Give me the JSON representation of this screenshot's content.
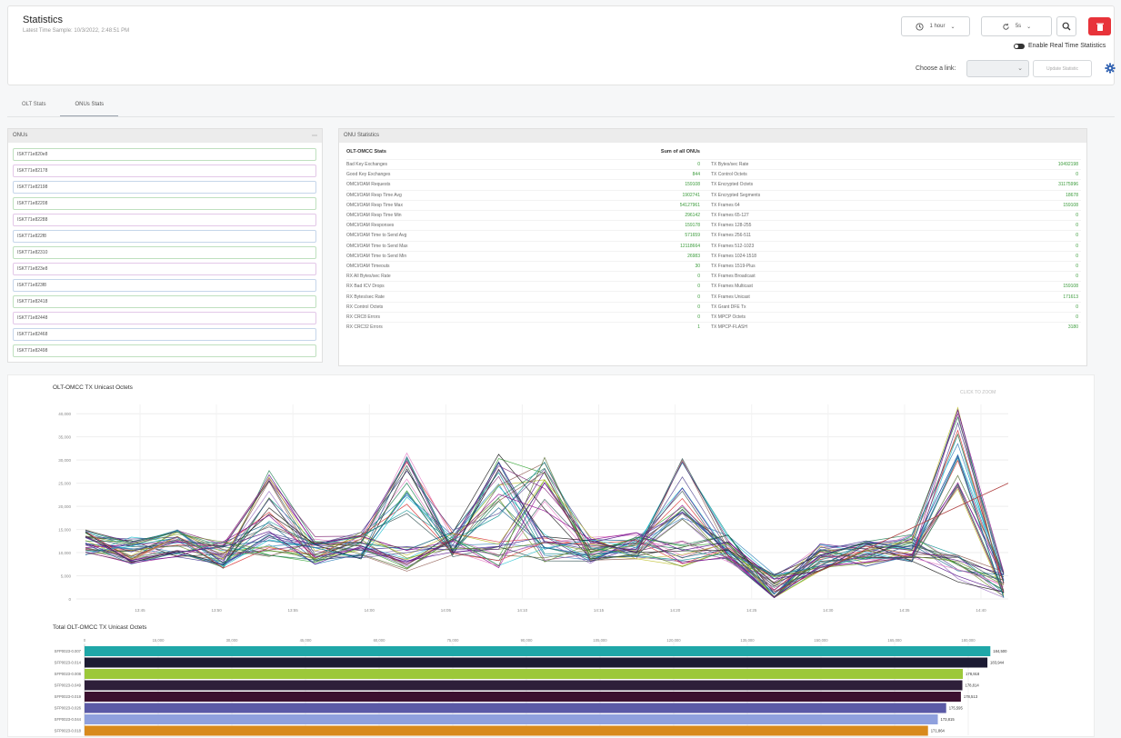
{
  "header": {
    "title": "Statistics",
    "subtitle": "Latest Time Sample: 10/3/2022, 2:48:51 PM",
    "time_range": "1 hour",
    "interval": "5s",
    "toggle_label": "Enable Real Time Statistics",
    "choose_link_label": "Choose a link:",
    "update_button": "Update Statistic"
  },
  "tabs": [
    "OLT Stats",
    "ONUs Stats"
  ],
  "left_panel": {
    "title": "ONUs",
    "items": [
      "ISKT71e820e8",
      "ISKT71e82178",
      "ISKT71e82198",
      "ISKT71e82208",
      "ISKT71e82288",
      "ISKT71e822f8",
      "ISKT71e82310",
      "ISKT71e823e8",
      "ISKT71e823f8",
      "ISKT71e82418",
      "ISKT71e82448",
      "ISKT71e82468",
      "ISKT71e82498"
    ]
  },
  "right_panel": {
    "title": "ONU Statistics",
    "col1_header": "OLT-OMCC Stats",
    "col2_header": "Sum of all ONUs",
    "rows": [
      {
        "name": "Bad Key Exchanges",
        "value": "0",
        "name2": "TX Bytes/sec Rate",
        "value2": "10492198"
      },
      {
        "name": "Good Key Exchanges",
        "value": "844",
        "name2": "TX Control Octets",
        "value2": "0"
      },
      {
        "name": "OMCI/OAM Requests",
        "value": "159108",
        "name2": "TX Encrypted Octets",
        "value2": "31175996"
      },
      {
        "name": "OMCI/OAM Resp Time Avg",
        "value": "1902741",
        "name2": "TX Encrypted Segments",
        "value2": "18678"
      },
      {
        "name": "OMCI/OAM Resp Time Max",
        "value": "54127961",
        "name2": "TX Frames 64",
        "value2": "159108"
      },
      {
        "name": "OMCI/OAM Resp Time Min",
        "value": "296142",
        "name2": "TX Frames 65-127",
        "value2": "0"
      },
      {
        "name": "OMCI/OAM Responses",
        "value": "159178",
        "name2": "TX Frames 128-255",
        "value2": "0"
      },
      {
        "name": "OMCI/OAM Time to Send Avg",
        "value": "571659",
        "name2": "TX Frames 256-511",
        "value2": "0"
      },
      {
        "name": "OMCI/OAM Time to Send Max",
        "value": "12118664",
        "name2": "TX Frames 512-1023",
        "value2": "0"
      },
      {
        "name": "OMCI/OAM Time to Send Min",
        "value": "26983",
        "name2": "TX Frames 1024-1518",
        "value2": "0"
      },
      {
        "name": "OMCI/OAM Timeouts",
        "value": "30",
        "name2": "TX Frames 1519-Plus",
        "value2": "0"
      },
      {
        "name": "RX All Bytes/sec Rate",
        "value": "0",
        "name2": "TX Frames Broadcast",
        "value2": "0"
      },
      {
        "name": "RX Bad ICV Drops",
        "value": "0",
        "name2": "TX Frames Multicast",
        "value2": "159108"
      },
      {
        "name": "RX Bytes/sec Rate",
        "value": "0",
        "name2": "TX Frames Unicast",
        "value2": "171613"
      },
      {
        "name": "RX Control Octets",
        "value": "0",
        "name2": "TX Grant DFE Tx",
        "value2": "0"
      },
      {
        "name": "RX CRC8 Errors",
        "value": "0",
        "name2": "TX MPCP Octets",
        "value2": "0"
      },
      {
        "name": "RX CRC32 Errors",
        "value": "1",
        "name2": "TX MPCP-FLASH",
        "value2": "3180"
      }
    ]
  },
  "line_chart_title": "OLT-OMCC TX Unicast Octets",
  "reset_zoom": "CLICK TO ZOOM",
  "bar_chart_title": "Total OLT-OMCC TX Unicast Octets",
  "colors": {
    "accent_red": "#e8333a",
    "value_green": "#3a9a3a"
  },
  "icons": {
    "clock": "clock-icon",
    "refresh": "refresh-icon",
    "zoom": "zoom-icon",
    "delete": "trash-icon",
    "settings": "gear-icon"
  },
  "chart_data": [
    {
      "type": "line",
      "title": "OLT-OMCC TX Unicast Octets",
      "y_ticks": [
        "40,000",
        "35,000",
        "30,000",
        "25,000",
        "20,000",
        "15,000",
        "10,000",
        "5,000",
        "0"
      ],
      "x_ticks": [
        "13:45",
        "13:50",
        "13:55",
        "14:00",
        "14:05",
        "14:10",
        "14:15",
        "14:20",
        "14:25",
        "14:30",
        "14:35",
        "14:40"
      ],
      "ylim": [
        0,
        42000
      ],
      "series_count": 40,
      "profile": [
        12000,
        10500,
        12000,
        9500,
        12000,
        10500,
        11500,
        9000,
        12000,
        9500,
        11000,
        10500,
        11500,
        9800,
        11000,
        2500,
        9000,
        10000,
        11000,
        6500,
        3000
      ],
      "peaks": {
        "4": 28000,
        "7": 33000,
        "9": 32000,
        "10": 33000,
        "13": 30500,
        "19": 42000
      },
      "legend": "none",
      "grid": true
    },
    {
      "type": "bar",
      "orientation": "horizontal",
      "title": "Total OLT-OMCC TX Unicast Octets",
      "categories": [
        "SFP0023-0.007",
        "SFP0023-0.014",
        "SFP0023-0.008",
        "SFP0023-0.049",
        "SFP0023-0.019",
        "SFP0023-0.026",
        "SFP0023-0.044",
        "SFP0023-0.018"
      ],
      "values": [
        184500,
        183900,
        178900,
        178800,
        178500,
        175500,
        173800,
        171800
      ],
      "value_labels": [
        "184,500",
        "183,944",
        "178,918",
        "178,814",
        "178,513",
        "175,595",
        "173,815",
        "171,864"
      ],
      "x_ticks": [
        "0",
        "15,000",
        "30,000",
        "45,000",
        "60,000",
        "75,000",
        "90,000",
        "105,000",
        "120,000",
        "135,000",
        "150,000",
        "165,000",
        "180,000"
      ],
      "xlim": [
        0,
        190000
      ],
      "colors": [
        "#1fa7a8",
        "#1c1b33",
        "#9cc83a",
        "#2e1f3a",
        "#3c1130",
        "#5b5aa6",
        "#8fa0dd",
        "#d88a1c"
      ]
    }
  ]
}
